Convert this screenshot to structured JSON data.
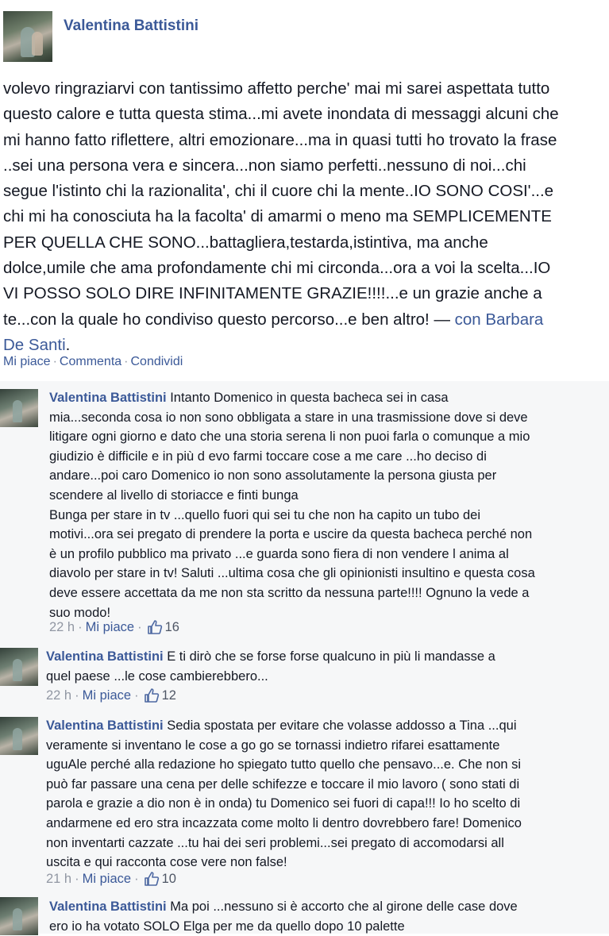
{
  "post": {
    "author": "Valentina Battistini",
    "body": "volevo ringraziarvi con tantissimo affetto perche' mai mi sarei aspettata tutto\nquesto calore e tutta questa stima...mi avete inondata di messaggi alcuni che\nmi hanno fatto riflettere, altri emozionare...ma in quasi tutti ho trovato la frase\n..sei una persona vera e sincera...non siamo perfetti..nessuno di noi...chi\nsegue l'istinto chi la razionalita', chi il cuore chi la mente..IO SONO COSI'...e\nchi mi ha conosciuta ha la facolta' di amarmi o meno ma SEMPLICEMENTE\nPER QUELLA CHE SONO...battagliera,testarda,istintiva, ma anche\ndolce,umile che ama profondamente chi mi circonda...ora a voi la scelta...IO\nVI POSSO SOLO DIRE INFINITAMENTE GRAZIE!!!!...e un grazie anche a\nte...con la quale ho condiviso questo percorso...e ben altro! — ",
    "tag_text": "con Barbara\nDe Santi",
    "tag_end": ".",
    "actions": {
      "like": "Mi piace",
      "comment": "Commenta",
      "share": "Condividi",
      "separator": "·"
    }
  },
  "comments": [
    {
      "author": "Valentina Battistini",
      "text": " Intanto Domenico in questa bacheca sei in casa\nmia...seconda cosa io non sono obbligata a stare in una trasmissione dove si deve\nlitigare ogni giorno e dato che una storia serena li non puoi farla o comunque a mio\ngiudizio è difficile e in più d evo farmi toccare cose a me care ...ho deciso di\nandare...poi caro Domenico io non sono assolutamente la persona giusta per\nscendere al livello di storiacce e finti bunga\nBunga per stare in tv ...quello fuori qui sei tu che non ha capito un tubo dei\nmotivi...ora sei pregato di prendere la porta e uscire da questa bacheca perché non\nè un profilo pubblico ma privato ...e guarda sono fiera di non vendere l anima al\ndiavolo per stare in tv! Saluti ...ultima cosa che gli opinionisti insultino e questa cosa\ndeve essere accettata da me non sta scritto da nessuna parte!!!! Ognuno la vede a\nsuo modo!",
      "time": "22 h",
      "like": "Mi piace",
      "likes": "16"
    },
    {
      "author": "Valentina Battistini",
      "text": " E ti dirò che se forse forse qualcuno in più li mandasse a\nquel paese ...le cose cambierebbero...",
      "time": "22 h",
      "like": "Mi piace",
      "likes": "12"
    },
    {
      "author": "Valentina Battistini",
      "text": " Sedia spostata per evitare che volasse addosso a Tina ...qui\nveramente si inventano le cose a go go se tornassi indietro rifarei esattamente\nuguAle perché alla redazione ho spiegato tutto quello che pensavo...e. Che non si\npuò far passare una cena per delle schifezze e toccare il mio lavoro ( sono stati di\nparola e grazie a dio non è in onda) tu Domenico sei fuori di capa!!! Io ho scelto di\nandarmene ed ero stra incazzata come molto li dentro dovrebbero fare! Domenico\nnon inventarti cazzate ...tu hai dei seri problemi...sei pregato di accomodarsi all\nuscita e qui racconta cose vere non false!",
      "time": "21 h",
      "like": "Mi piace",
      "likes": "10"
    },
    {
      "author": "Valentina Battistini",
      "text": " Ma poi ...nessuno si è accorto che al girone delle case dove\nero io ha votato SOLO Elga per me da quello dopo 10 palette",
      "time": "",
      "like": "",
      "likes": ""
    }
  ],
  "meta_separator": "·",
  "icons": {
    "avatar": "profile-photo",
    "like": "thumbs-up-icon"
  },
  "colors": {
    "link": "#3b5998",
    "meta": "#9197a3",
    "text": "#141823",
    "comment_bg": "#f6f7f8"
  }
}
